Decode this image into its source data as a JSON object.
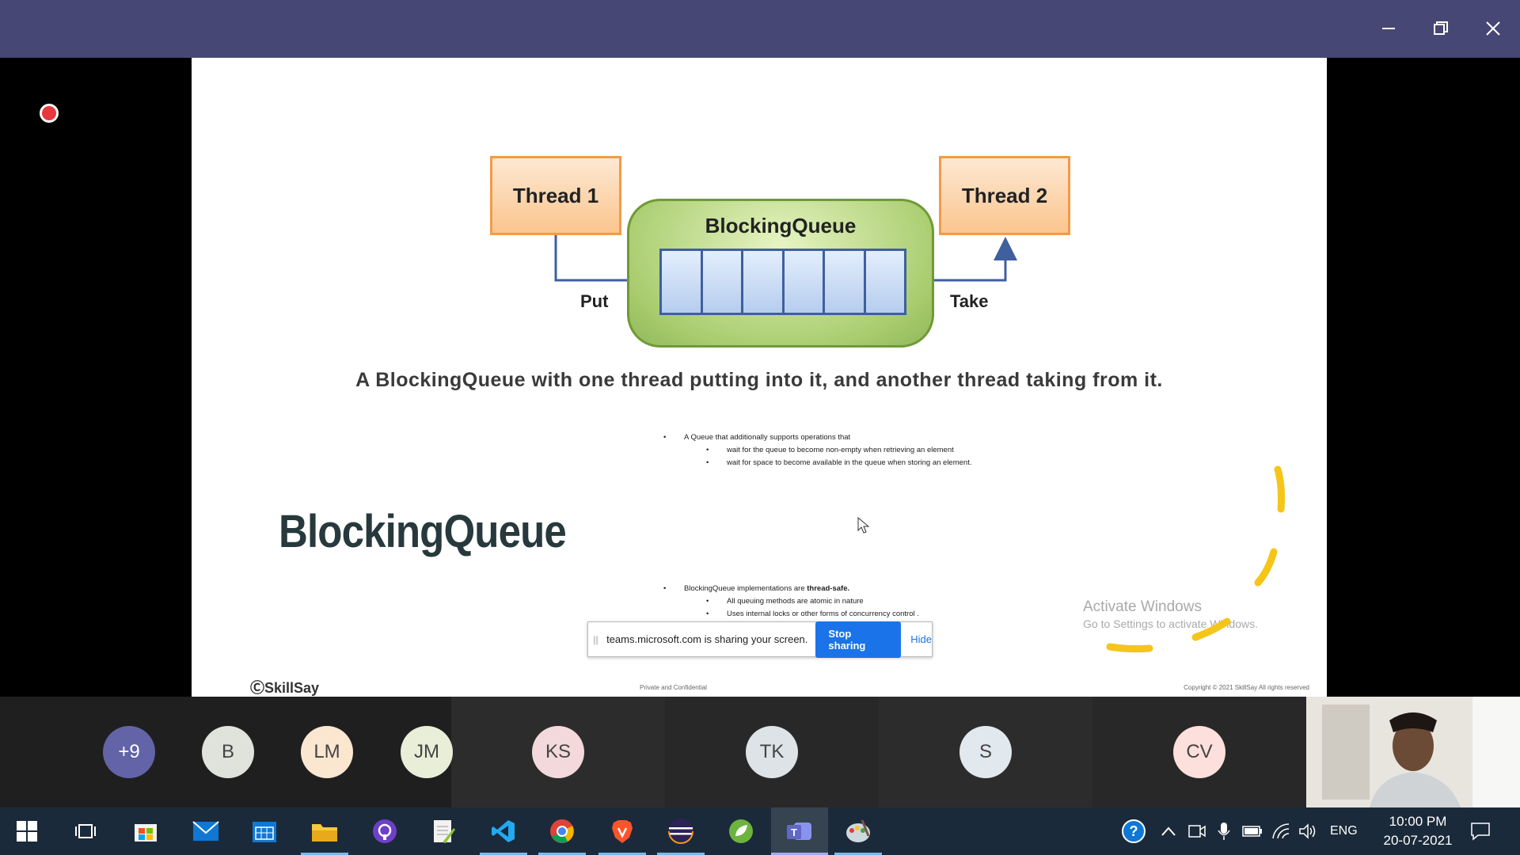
{
  "window": {
    "minimize_icon": "minimize-icon",
    "maximize_icon": "restore-icon",
    "close_icon": "close-icon"
  },
  "slide": {
    "diagram": {
      "thread1": "Thread 1",
      "thread2": "Thread 2",
      "queue_title": "BlockingQueue",
      "put_label": "Put",
      "take_label": "Take",
      "cell_count": 6
    },
    "caption": "A BlockingQueue with one thread putting into it, and another thread taking from it.",
    "bullets_top": {
      "main": "A Queue that additionally supports operations that",
      "sub": [
        "wait for the queue to become non-empty when retrieving an element",
        "wait for space to become available in the queue when storing an element."
      ]
    },
    "title": "BlockingQueue",
    "bullets_bottom": {
      "main_prefix": "BlockingQueue implementations are ",
      "main_bold": "thread-safe.",
      "sub": [
        "All queuing methods are atomic in nature",
        "Uses internal  locks or other forms of concurrency control ."
      ]
    },
    "footer_logo": "SkillSay",
    "footer_mid": "Private and Confidential",
    "footer_right": "Copyright © 2021 SkillSay All rights reserved"
  },
  "share_bar": {
    "text": "teams.microsoft.com is sharing your screen.",
    "stop_label": "Stop sharing",
    "hide_label": "Hide"
  },
  "activate_windows": {
    "line1": "Activate Windows",
    "line2": "Go to Settings to activate Windows."
  },
  "participants": [
    {
      "initials": "+9",
      "bg": "#6264a7",
      "fg": "#ffffff"
    },
    {
      "initials": "B",
      "bg": "#dfe3dc",
      "fg": "#444444"
    },
    {
      "initials": "LM",
      "bg": "#fbe6d0",
      "fg": "#444444"
    },
    {
      "initials": "JM",
      "bg": "#e9eed8",
      "fg": "#444444"
    },
    {
      "initials": "KS",
      "bg": "#f3d9dc",
      "fg": "#444444"
    },
    {
      "initials": "TK",
      "bg": "#dde3e6",
      "fg": "#444444"
    },
    {
      "initials": "S",
      "bg": "#e1e8ee",
      "fg": "#444444"
    },
    {
      "initials": "CV",
      "bg": "#fde0dc",
      "fg": "#444444"
    }
  ],
  "taskbar": {
    "apps": [
      "start-icon",
      "task-view-icon",
      "store-icon",
      "mail-icon",
      "calendar-icon",
      "file-explorer-icon",
      "github-icon",
      "notepad-plus-icon",
      "vscode-icon",
      "chrome-icon",
      "brave-icon",
      "eclipse-icon",
      "spring-icon",
      "teams-icon",
      "paint-icon"
    ],
    "language": "ENG",
    "time": "10:00 PM",
    "date": "20-07-2021"
  },
  "colors": {
    "titlebar": "#464775",
    "stop_button": "#1a73e8",
    "taskbar": "#1b2a3a",
    "annotation": "#f5c518"
  }
}
